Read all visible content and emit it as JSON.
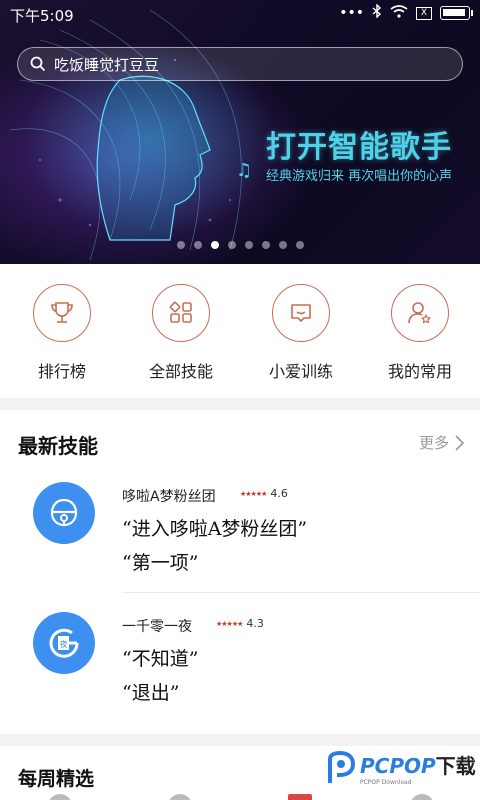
{
  "status_bar": {
    "time": "下午5:09",
    "sim_label": "X"
  },
  "search": {
    "placeholder": "吃饭睡觉打豆豆"
  },
  "banner": {
    "title": "打开智能歌手",
    "subtitle": "经典游戏归来 再次唱出你的心声",
    "page_count": 8,
    "active_page": 3
  },
  "quick_actions": [
    {
      "label": "排行榜",
      "icon": "trophy-icon"
    },
    {
      "label": "全部技能",
      "icon": "grid-icon"
    },
    {
      "label": "小爱训练",
      "icon": "chat-train-icon"
    },
    {
      "label": "我的常用",
      "icon": "user-star-icon"
    }
  ],
  "newest": {
    "title": "最新技能",
    "more_label": "更多",
    "items": [
      {
        "name": "哆啦A梦粉丝团",
        "rating": "4.6",
        "quote1": "“进入哆啦A梦粉丝团”",
        "quote2": "“第一项”",
        "icon": "bell-icon"
      },
      {
        "name": "一千零一夜",
        "rating": "4.3",
        "quote1": "“不知道”",
        "quote2": "“退出”",
        "icon": "night-book-icon"
      }
    ]
  },
  "weekly": {
    "title": "每周精选"
  },
  "watermark": {
    "brand": "PCPOP",
    "brand_cn": "下载",
    "sub": "PCPOP Download"
  },
  "colors": {
    "accent": "#c96e52",
    "banner_text": "#4fd2e8",
    "skill_blue": "#3d8ff0"
  }
}
